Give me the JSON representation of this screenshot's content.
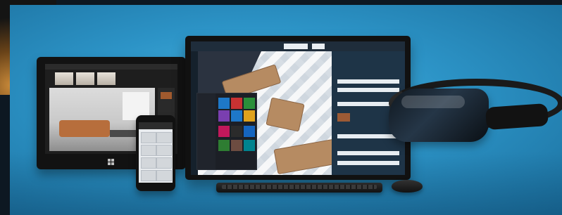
{
  "image": {
    "accent_background": "#2c93c6",
    "device_bezel_color": "#111111",
    "sofa_color": "#b76e3c"
  }
}
